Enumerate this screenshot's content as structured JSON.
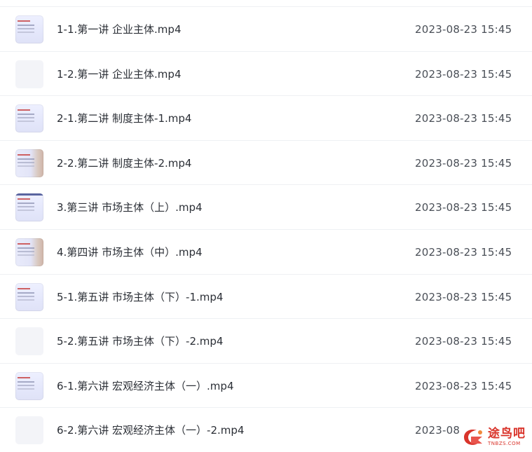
{
  "files": [
    {
      "name": "1-1.第一讲 企业主体.mp4",
      "date": "2023-08-23 15:45",
      "thumb": "video-thumbnail"
    },
    {
      "name": "1-2.第一讲 企业主体.mp4",
      "date": "2023-08-23 15:45",
      "thumb": "blank-thumbnail"
    },
    {
      "name": "2-1.第二讲 制度主体-1.mp4",
      "date": "2023-08-23 15:45",
      "thumb": "video-thumbnail"
    },
    {
      "name": "2-2.第二讲 制度主体-2.mp4",
      "date": "2023-08-23 15:45",
      "thumb": "video-thumbnail"
    },
    {
      "name": "3.第三讲 市场主体（上）.mp4",
      "date": "2023-08-23 15:45",
      "thumb": "video-thumbnail"
    },
    {
      "name": "4.第四讲 市场主体（中）.mp4",
      "date": "2023-08-23 15:45",
      "thumb": "video-thumbnail"
    },
    {
      "name": "5-1.第五讲 市场主体（下）-1.mp4",
      "date": "2023-08-23 15:45",
      "thumb": "video-thumbnail"
    },
    {
      "name": "5-2.第五讲 市场主体（下）-2.mp4",
      "date": "2023-08-23 15:45",
      "thumb": "blank-thumbnail"
    },
    {
      "name": "6-1.第六讲 宏观经济主体（一）.mp4",
      "date": "2023-08-23 15:45",
      "thumb": "video-thumbnail"
    },
    {
      "name": "6-2.第六讲 宏观经济主体（一）-2.mp4",
      "date": "2023-08",
      "thumb": "blank-thumbnail"
    }
  ],
  "watermark": {
    "text_cn": "途鸟吧",
    "text_en": "TNBZS.COM",
    "color": "#d9342b"
  }
}
